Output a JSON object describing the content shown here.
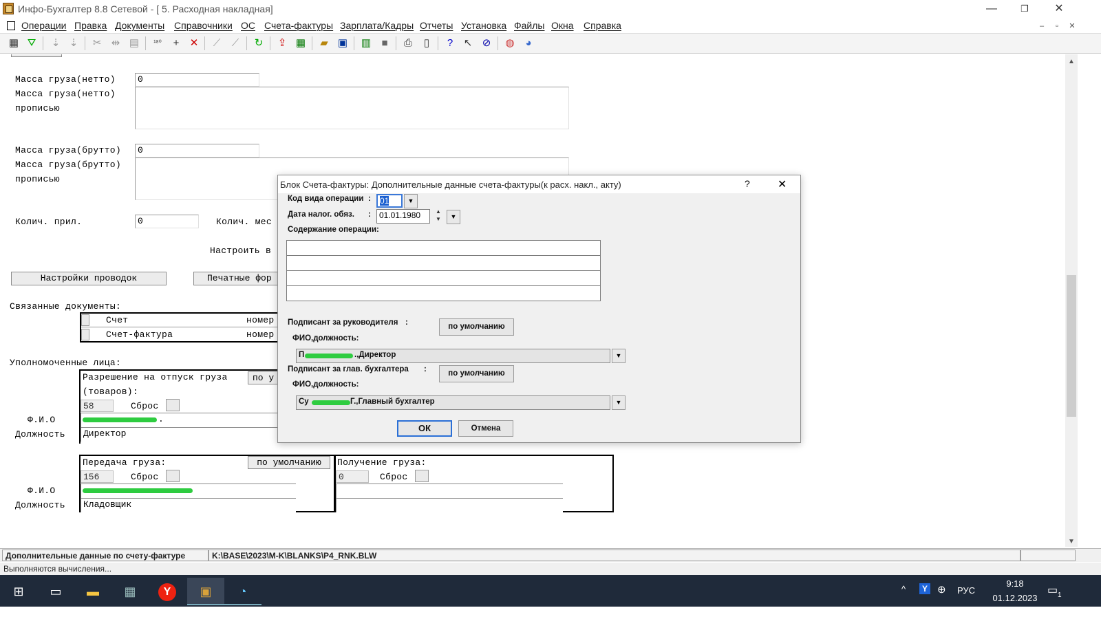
{
  "window": {
    "title": "Инфо-Бухгалтер 8.8 Сетевой - [  5. Расходная накладная]",
    "minimize": "—",
    "restore": "❐",
    "close": "✕"
  },
  "menu": [
    "Операции",
    "Правка",
    "Документы",
    "Справочники",
    "ОС",
    "Счета-фактуры",
    "Зарплата/Кадры",
    "Отчеты",
    "Установка",
    "Файлы",
    "Окна",
    "Справка"
  ],
  "mdi": {
    "minimize": "–",
    "restore": "▫",
    "close": "✕"
  },
  "toolbar_icons": [
    "grid-icon",
    "filter-icon",
    "sort-asc-icon",
    "sort-desc-icon",
    "cut-icon",
    "align-icon",
    "paste-icon",
    "counter-icon",
    "add-icon",
    "delete-icon",
    "tool-a-icon",
    "tool-b-icon",
    "refresh-icon",
    "export-icon",
    "sheet-icon",
    "open-icon",
    "save-icon",
    "chart-icon",
    "box-icon",
    "print-icon",
    "calc-icon",
    "help-icon",
    "whats-this-icon",
    "compass-icon",
    "lifebuoy-icon",
    "globe-icon"
  ],
  "form": {
    "net_weight_label": "Масса груза(нетто)",
    "net_weight_value": "0",
    "net_weight_words_label_1": "Масса груза(нетто)",
    "net_weight_words_label_2": "прописью",
    "gross_weight_label": "Масса груза(брутто)",
    "gross_weight_value": "0",
    "gross_weight_words_label_1": "Масса груза(брутто)",
    "gross_weight_words_label_2": "прописью",
    "attach_count_label": "Колич. прил.",
    "attach_count_value": "0",
    "places_count_label": "Колич. мес",
    "setup_label": "Настроить в",
    "postings_button": "Настройки проводок",
    "print_forms_button": "Печатные фор",
    "related_docs_label": "Связанные документы:",
    "related_docs": [
      {
        "name": "Счет",
        "num": "номер"
      },
      {
        "name": "Счет-фактура",
        "num": "номер"
      }
    ],
    "authorized_label": "Уполномоченные лица:",
    "release_permit_label_1": "Разрешение на отпуск груза",
    "release_permit_label_2": "(товаров):",
    "release_default_short": "по у",
    "release_code": "58",
    "reset_label": "Сброс",
    "fio_label": "Ф.И.О",
    "position_label": "Должность",
    "release_fio_suffix": ".",
    "release_position": "Директор",
    "transfer_label": "Передача груза:",
    "transfer_default": "по умолчанию",
    "transfer_code": "156",
    "transfer_position": "Кладовщик",
    "receive_label": "Получение груза:",
    "receive_code": "0"
  },
  "dialog": {
    "title": "Блок Счета-фактуры: Дополнительные данные счета-фактуры(к расх. накл., акту)",
    "help": "?",
    "close": "✕",
    "op_code_label": "Код вида операции",
    "op_code_value": "01",
    "tax_date_label": "Дата налог. обяз.",
    "tax_date_value": "01.01.1980",
    "colon": ":",
    "content_label": "Содержание операции:",
    "content_lines": [
      "",
      "",
      "",
      ""
    ],
    "head_signer_label": "Подписант за руководителя",
    "default_button": "по умолчанию",
    "fio_position_label": "ФИО,должность:",
    "head_signer_prefix": "П",
    "head_signer_suffix": ".,Директор",
    "chief_acc_label": "Подписант за глав. бухгалтера",
    "chief_signer_prefix": "Су",
    "chief_signer_suffix": "Г.,Главный бухгалтер",
    "ok_button": "ОК",
    "cancel_button": "Отмена"
  },
  "status": {
    "left": "Дополнительные данные по счету-фактуре",
    "path": "K:\\BASE\\2023\\M-K\\BLANKS\\P4_RNK.BLW",
    "progress": "Выполняются вычисления..."
  },
  "taskbar": {
    "lang": "РУС",
    "time": "9:18",
    "date": "01.12.2023",
    "notification_count": "1"
  },
  "colors": {
    "accent_green": "#2ecc40",
    "taskbar": "#1f2a3a"
  }
}
